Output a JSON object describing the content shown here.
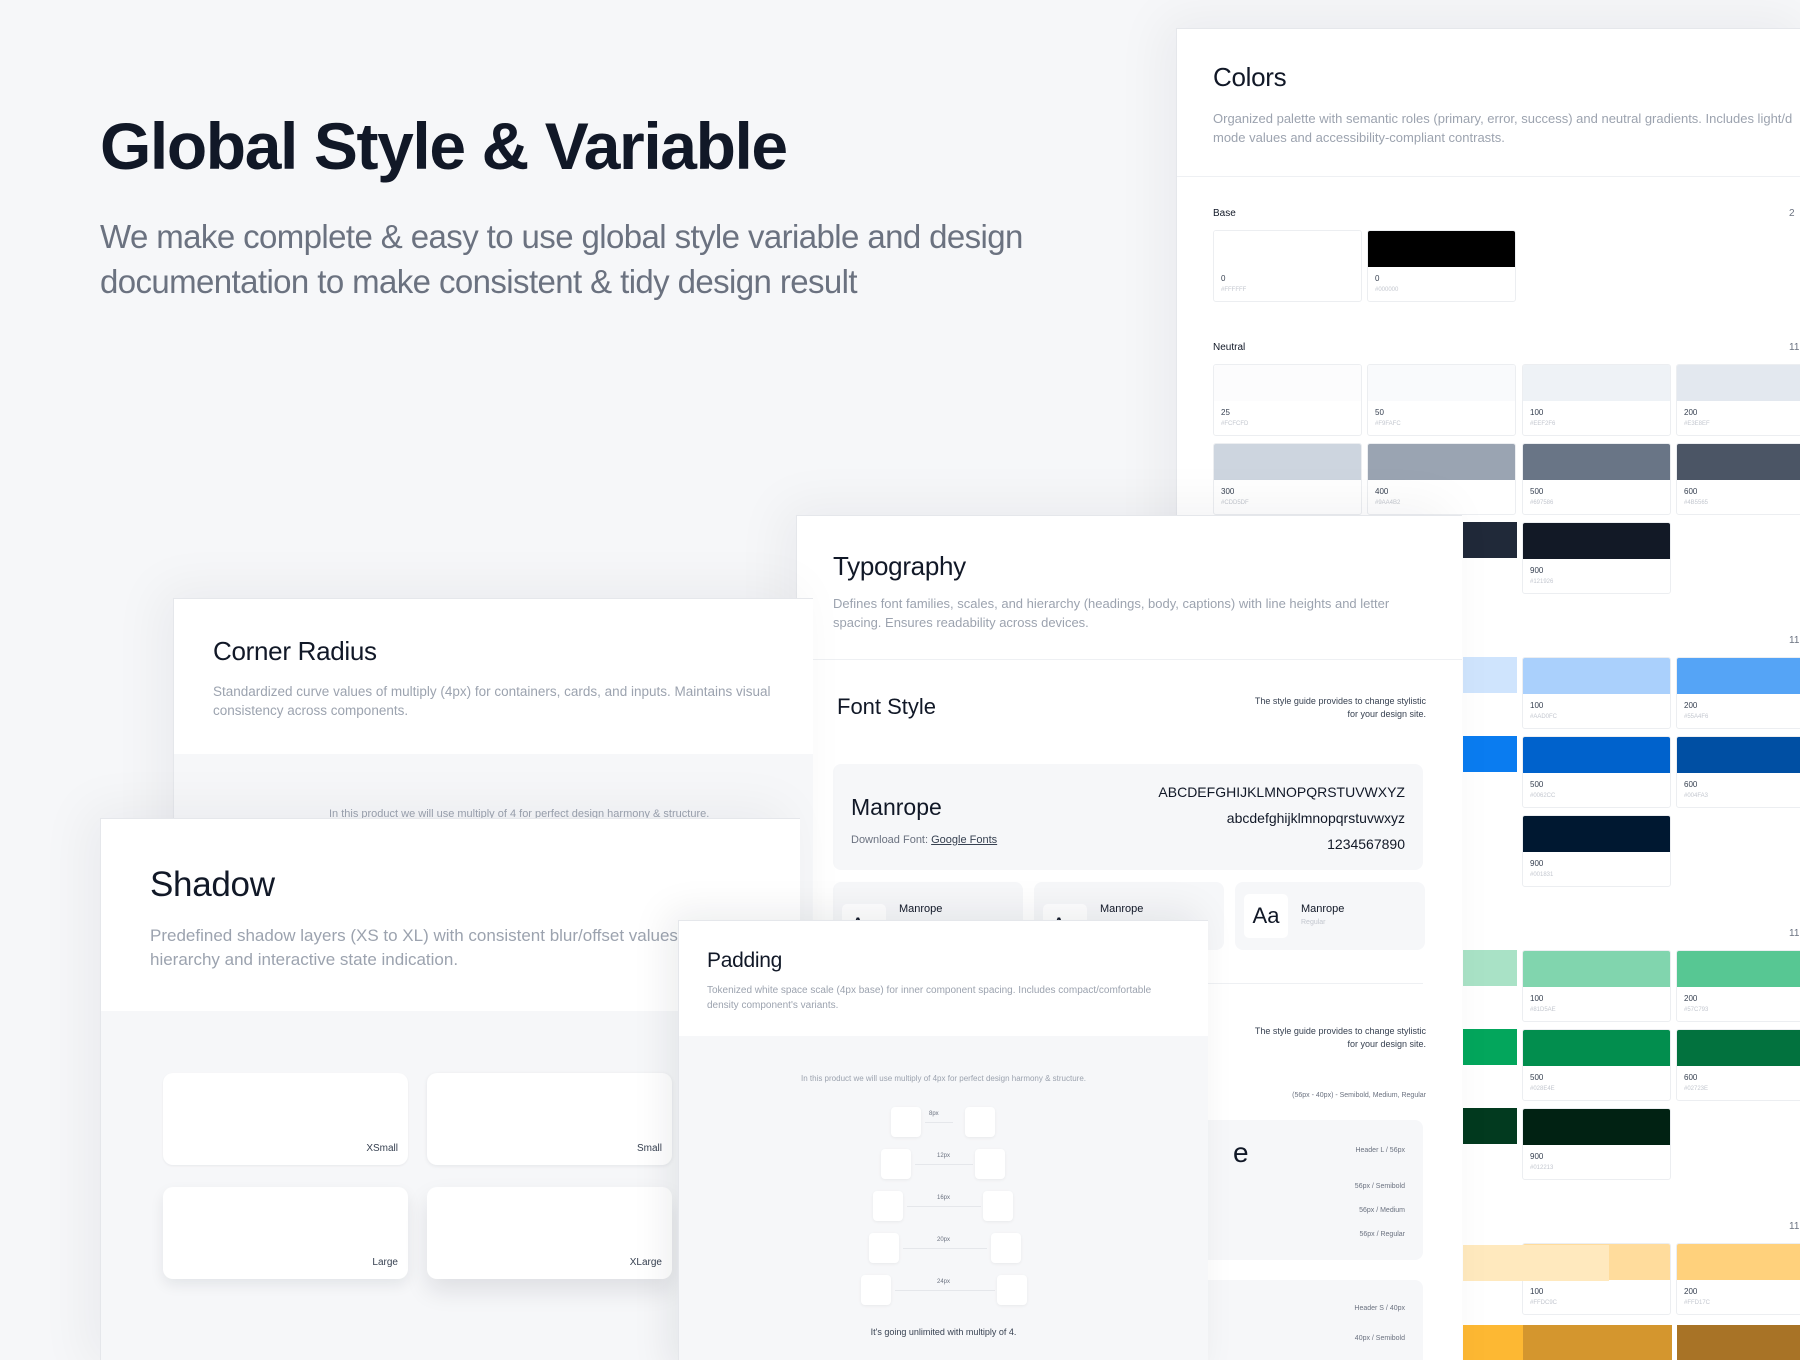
{
  "hero": {
    "title": "Global Style & Variable",
    "subtitle": "We make complete & easy to use global style variable and design documentation to make consistent & tidy design result"
  },
  "colors": {
    "title": "Colors",
    "description": "Organized palette with semantic roles (primary, error, success) and neutral gradients. Includes light/d mode values and accessibility-compliant contrasts.",
    "base": {
      "label": "Base",
      "count": "2",
      "swatches": [
        {
          "num": "0",
          "hex": "#FFFFFF",
          "color": "#FFFFFF"
        },
        {
          "num": "0",
          "hex": "#000000",
          "color": "#000000"
        }
      ]
    },
    "neutral": {
      "label": "Neutral",
      "count": "11",
      "swatches": [
        {
          "num": "25",
          "hex": "#FCFCFD",
          "color": "#FCFCFD"
        },
        {
          "num": "50",
          "hex": "#F9FAFC",
          "color": "#F9FAFC"
        },
        {
          "num": "100",
          "hex": "#EEF2F6",
          "color": "#EEF2F6"
        },
        {
          "num": "200",
          "hex": "#E3E8EF",
          "color": "#E3E8EF"
        },
        {
          "num": "300",
          "hex": "#CDD5DF",
          "color": "#CDD5DF"
        },
        {
          "num": "400",
          "hex": "#9AA4B2",
          "color": "#9AA4B2"
        },
        {
          "num": "500",
          "hex": "#697586",
          "color": "#697586"
        },
        {
          "num": "600",
          "hex": "#4B5565",
          "color": "#4B5565"
        },
        {
          "num": "900",
          "hex": "#121926",
          "color": "#121926"
        }
      ]
    },
    "blue": {
      "count": "11",
      "swatches": [
        {
          "num": "100",
          "hex": "#AAD0FC",
          "color": "#AAD0FC"
        },
        {
          "num": "200",
          "hex": "#55A4F6",
          "color": "#55A4F6"
        },
        {
          "num": "500",
          "hex": "#0062CC",
          "color": "#0062CC"
        },
        {
          "num": "600",
          "hex": "#004FA3",
          "color": "#004FA3"
        },
        {
          "num": "900",
          "hex": "#001831",
          "color": "#001831"
        }
      ]
    },
    "green": {
      "count": "11",
      "swatches": [
        {
          "num": "100",
          "hex": "#81D5AE",
          "color": "#81D5AE"
        },
        {
          "num": "200",
          "hex": "#57C793",
          "color": "#57C793"
        },
        {
          "num": "500",
          "hex": "#028E4E",
          "color": "#028E4E"
        },
        {
          "num": "600",
          "hex": "#02723E",
          "color": "#02723E"
        },
        {
          "num": "900",
          "hex": "#012213",
          "color": "#012213"
        }
      ]
    },
    "yellow": {
      "count": "11",
      "swatches": [
        {
          "num": "100",
          "hex": "#FFDC9C",
          "color": "#FFDC9C"
        },
        {
          "num": "200",
          "hex": "#FFD17C",
          "color": "#FFD17C"
        }
      ]
    }
  },
  "typography": {
    "title": "Typography",
    "description": "Defines font families, scales, and hierarchy (headings, body, captions) with line heights and letter spacing. Ensures readability across devices.",
    "font_style_heading": "Font Style",
    "style_note": "The style guide provides to change stylistic for your design site.",
    "font_name": "Manrope",
    "download_label": "Download Font:",
    "download_link": "Google Fonts",
    "uppercase": "ABCDEFGHIJKLMNOPQRSTUVWXYZ",
    "lowercase": "abcdefghijklmnopqrstuvwxyz",
    "digits": "1234567890",
    "aa": "Aa",
    "weight_cards": [
      {
        "name": "Manrope",
        "kind": ""
      },
      {
        "name": "Manrope",
        "kind": ""
      },
      {
        "name": "Manrope",
        "kind": "Regular"
      }
    ],
    "style_note_2": "The style guide provides to change stylistic for your design site.",
    "sizes_note": "(56px - 40px) - Semibold, Medium, Regular",
    "cut_letter": "e",
    "scale_a": [
      "Header L / 56px",
      "56px / Semibold",
      "56px / Medium",
      "56px / Regular"
    ],
    "scale_b": [
      "Header S / 40px",
      "40px / Semibold"
    ]
  },
  "radius": {
    "title": "Corner Radius",
    "description": "Standardized curve values of multiply (4px) for containers, cards, and inputs. Maintains visual consistency across components.",
    "note": "In this product we will use multiply of 4 for perfect design harmony & structure."
  },
  "shadow": {
    "title": "Shadow",
    "description": "Predefined shadow layers (XS to XL) with consistent blur/offset values for depth hierarchy and interactive state indication.",
    "cards": [
      "XSmall",
      "Small",
      "Large",
      "XLarge"
    ]
  },
  "padding": {
    "title": "Padding",
    "description": "Tokenized white space scale (4px base) for inner component spacing. Includes compact/comfortable density component's variants.",
    "note": "In this product we will use multiply of 4px for perfect design harmony & structure.",
    "steps": [
      "8px",
      "12px",
      "16px",
      "20px",
      "24px"
    ],
    "footer": "It's going unlimited with multiply of 4."
  }
}
